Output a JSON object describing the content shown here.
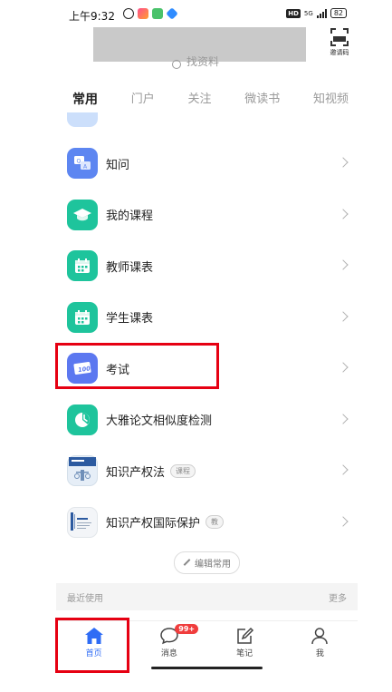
{
  "status_bar": {
    "time": "上午9:32",
    "network": "5G",
    "hd": "HD",
    "battery": "82"
  },
  "header": {
    "invite_label": "邀请码",
    "search_text": "找资料"
  },
  "tabs": [
    {
      "label": "常用",
      "active": true
    },
    {
      "label": "门户",
      "active": false
    },
    {
      "label": "关注",
      "active": false
    },
    {
      "label": "微读书",
      "active": false
    },
    {
      "label": "知视频",
      "active": false
    }
  ],
  "list": {
    "items": [
      {
        "label": "知问",
        "icon": "qa-icon",
        "tag": ""
      },
      {
        "label": "我的课程",
        "icon": "graduation-cap-icon",
        "tag": ""
      },
      {
        "label": "教师课表",
        "icon": "calendar-icon",
        "tag": ""
      },
      {
        "label": "学生课表",
        "icon": "calendar-icon",
        "tag": ""
      },
      {
        "label": "考试",
        "icon": "exam-paper-icon",
        "tag": ""
      },
      {
        "label": "大雅论文相似度检测",
        "icon": "plagiarism-check-icon",
        "tag": ""
      },
      {
        "label": "知识产权法",
        "icon": "ip-law-thumbnail-icon",
        "tag": "课程"
      },
      {
        "label": "知识产权国际保护",
        "icon": "wipo-thumbnail-icon",
        "tag": "教"
      }
    ],
    "edit_button": "编辑常用"
  },
  "recent": {
    "label": "最近使用",
    "more": "更多"
  },
  "bottom_nav": [
    {
      "label": "首页",
      "active": true,
      "icon": "home-icon"
    },
    {
      "label": "消息",
      "active": false,
      "icon": "message-icon",
      "badge": "99+"
    },
    {
      "label": "笔记",
      "active": false,
      "icon": "note-icon"
    },
    {
      "label": "我",
      "active": false,
      "icon": "profile-icon"
    }
  ],
  "colors": {
    "accent": "#2f6cf5",
    "highlight": "#e60012",
    "badge": "#f03d3d"
  }
}
